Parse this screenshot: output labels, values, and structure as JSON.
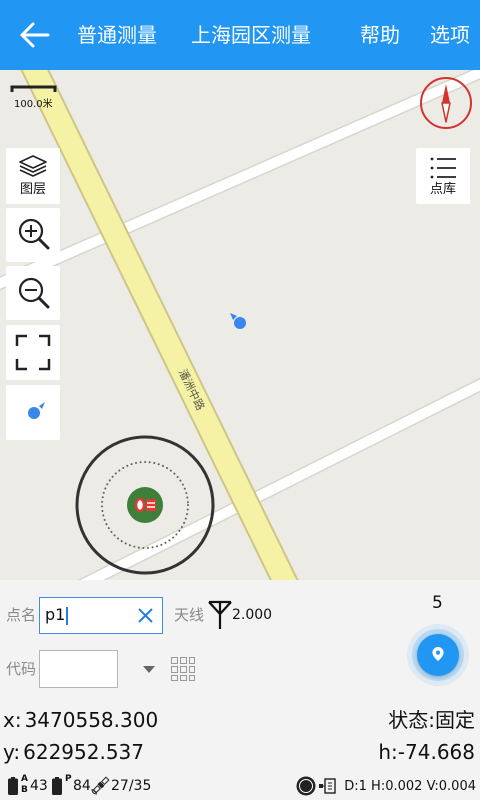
{
  "topbar": {
    "tabs": [
      {
        "label": "普通测量"
      },
      {
        "label": "上海园区测量"
      },
      {
        "label": "帮助"
      },
      {
        "label": "选项"
      }
    ]
  },
  "map": {
    "scale_label": "100.0米",
    "road_label": "潘洲中路",
    "layers_button_label": "图层",
    "point_library_button_label": "点库"
  },
  "form": {
    "point_name_label": "点名",
    "point_name_value": "p1",
    "antenna_label": "天线",
    "antenna_height": "2.000",
    "counter": "5",
    "code_label": "代码",
    "code_value": ""
  },
  "coordinates": {
    "x_label": "x:",
    "x_value": "3470558.300",
    "y_label": "y:",
    "y_value": "622952.537",
    "status_label": "状态:",
    "status_value": "固定",
    "h_label": "h:",
    "h_value": "-74.668"
  },
  "status_bar": {
    "battery_1_label_top": "A",
    "battery_1_label_bottom": "B",
    "battery_1_level": "43",
    "battery_2_label": "P",
    "battery_2_level": "84",
    "satellites": "27/35",
    "precision": "D:1 H:0.002 V:0.004"
  },
  "icons": {
    "back": "back-arrow-icon",
    "layers": "layers-icon",
    "zoom_in": "zoom-in-icon",
    "zoom_out": "zoom-out-icon",
    "fullscreen": "fullscreen-icon",
    "my_location": "my-location-icon",
    "point_library": "list-icon",
    "compass": "compass-icon",
    "clear": "close-icon",
    "antenna": "antenna-icon",
    "dropdown": "chevron-down-icon",
    "grid": "grid-icon",
    "locate_button": "location-pin-icon",
    "battery": "battery-icon",
    "satellite": "satellite-icon",
    "record": "record-icon",
    "device": "device-icon"
  },
  "colors": {
    "accent": "#2196f3",
    "compass": "#d0342c",
    "fix_marker": "#3f7e3b",
    "major_road": "#f5f2a6",
    "map_background": "#ecebe5"
  }
}
